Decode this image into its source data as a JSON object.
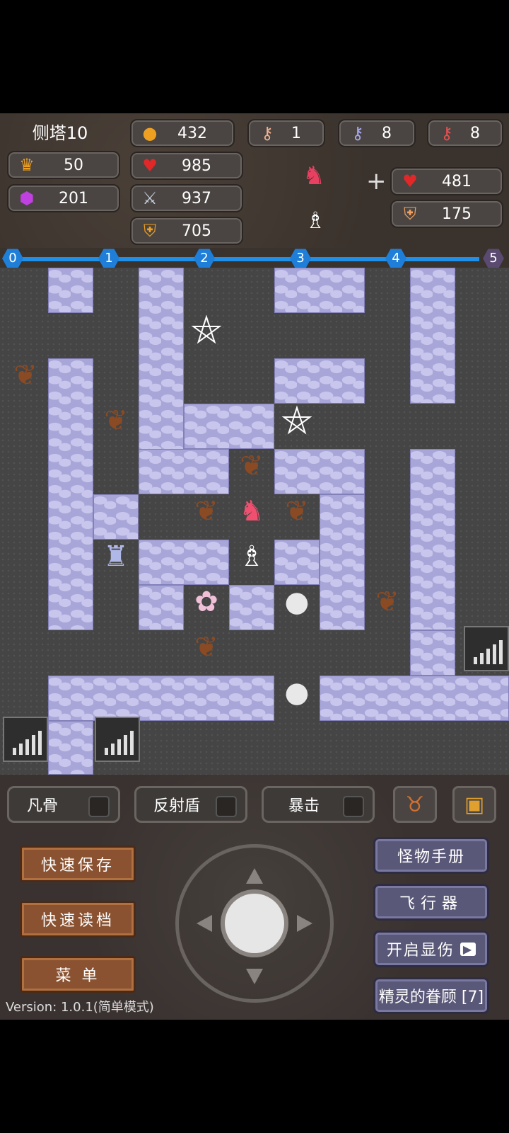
{
  "hud": {
    "floor_name": "侧塔10",
    "level": "50",
    "gems": "201",
    "gold": "432",
    "hp": "985",
    "attack": "937",
    "defense": "705",
    "key_yellow": "1",
    "key_blue": "8",
    "key_red": "8",
    "plus_sign": "+",
    "ally_hp": "481",
    "ally_def": "175"
  },
  "floor_track": {
    "nodes": [
      "0",
      "1",
      "2",
      "3",
      "4",
      "5"
    ],
    "current": "5"
  },
  "skills": [
    {
      "label": "凡骨"
    },
    {
      "label": "反射盾"
    },
    {
      "label": "暴击"
    }
  ],
  "icons": {
    "bag": "money-bag-icon",
    "chest": "treasure-chest-icon"
  },
  "menu_left": {
    "quick_save": "快速保存",
    "quick_load": "快速读档",
    "menu": "菜 单"
  },
  "menu_right": {
    "monster_book": "怪物手册",
    "fly": "飞行器",
    "show_damage": "开启显伤",
    "spirit_favor": "精灵的眷顾 [7]"
  },
  "version": "Version: 1.0.1(简单模式)",
  "colors": {
    "wall": "#a8a6d8",
    "floor": "#454545",
    "track": "#1f8fe8",
    "wood_button": "#8a5230",
    "purple_button": "#5a5878"
  }
}
